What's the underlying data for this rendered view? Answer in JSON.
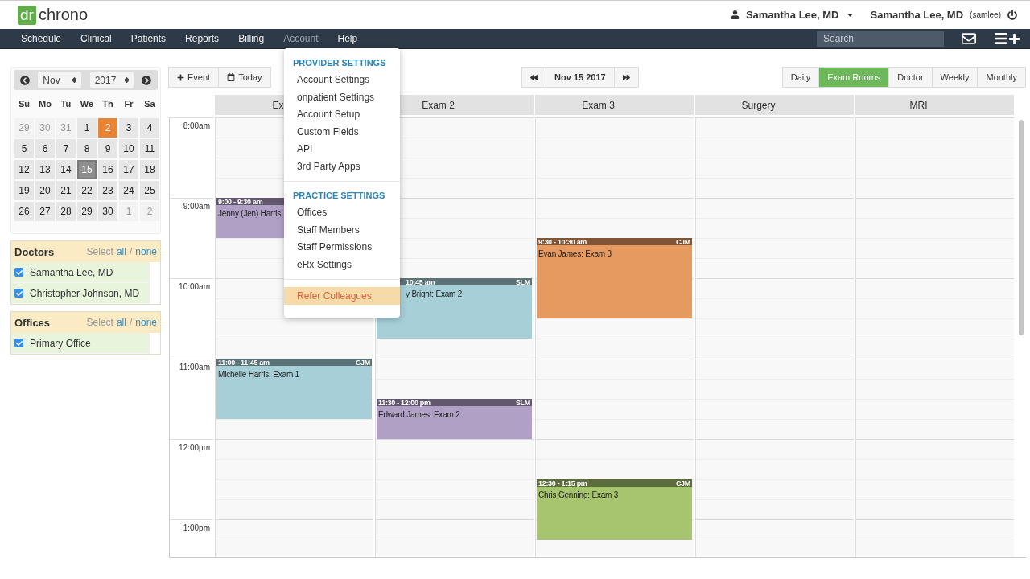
{
  "header": {
    "logo_mark": "dr",
    "logo_text": "chrono",
    "user_menu": "Samantha Lee, MD",
    "signed_in_name": "Samantha Lee, MD",
    "signed_in_login": "(samlee)"
  },
  "nav": {
    "items": [
      {
        "label": "Schedule",
        "hovered": false
      },
      {
        "label": "Clinical",
        "hovered": false
      },
      {
        "label": "Patients",
        "hovered": false
      },
      {
        "label": "Reports",
        "hovered": false
      },
      {
        "label": "Billing",
        "hovered": false
      },
      {
        "label": "Account",
        "hovered": true
      },
      {
        "label": "Help",
        "hovered": false
      }
    ],
    "search": {
      "placeholder": "Search"
    }
  },
  "account_menu": {
    "sections": [
      {
        "heading": "PROVIDER SETTINGS",
        "items": [
          {
            "label": "Account Settings",
            "highlighted": false
          },
          {
            "label": "onpatient Settings",
            "highlighted": false
          },
          {
            "label": "Account Setup",
            "highlighted": false
          },
          {
            "label": "Custom Fields",
            "highlighted": false
          },
          {
            "label": "API",
            "highlighted": false
          },
          {
            "label": "3rd Party Apps",
            "highlighted": false
          }
        ]
      },
      {
        "heading": "PRACTICE SETTINGS",
        "items": [
          {
            "label": "Offices",
            "highlighted": false
          },
          {
            "label": "Staff Members",
            "highlighted": false
          },
          {
            "label": "Staff Permissions",
            "highlighted": false
          },
          {
            "label": "eRx Settings",
            "highlighted": false
          }
        ]
      },
      {
        "items": [
          {
            "label": "Refer Colleagues",
            "highlighted": true
          }
        ]
      }
    ]
  },
  "mini_calendar": {
    "month": "Nov",
    "year": "2017",
    "weekdays": [
      "Su",
      "Mo",
      "Tu",
      "We",
      "Th",
      "Fr",
      "Sa"
    ],
    "days": [
      {
        "label": "29",
        "muted": true,
        "today": false,
        "selected": false
      },
      {
        "label": "30",
        "muted": true,
        "today": false,
        "selected": false
      },
      {
        "label": "31",
        "muted": true,
        "today": false,
        "selected": false
      },
      {
        "label": "1",
        "muted": false,
        "today": false,
        "selected": false
      },
      {
        "label": "2",
        "muted": false,
        "today": true,
        "selected": false
      },
      {
        "label": "3",
        "muted": false,
        "today": false,
        "selected": false
      },
      {
        "label": "4",
        "muted": false,
        "today": false,
        "selected": false
      },
      {
        "label": "5",
        "muted": false,
        "today": false,
        "selected": false
      },
      {
        "label": "6",
        "muted": false,
        "today": false,
        "selected": false
      },
      {
        "label": "7",
        "muted": false,
        "today": false,
        "selected": false
      },
      {
        "label": "8",
        "muted": false,
        "today": false,
        "selected": false
      },
      {
        "label": "9",
        "muted": false,
        "today": false,
        "selected": false
      },
      {
        "label": "10",
        "muted": false,
        "today": false,
        "selected": false
      },
      {
        "label": "11",
        "muted": false,
        "today": false,
        "selected": false
      },
      {
        "label": "12",
        "muted": false,
        "today": false,
        "selected": false
      },
      {
        "label": "13",
        "muted": false,
        "today": false,
        "selected": false
      },
      {
        "label": "14",
        "muted": false,
        "today": false,
        "selected": false
      },
      {
        "label": "15",
        "muted": false,
        "today": false,
        "selected": true
      },
      {
        "label": "16",
        "muted": false,
        "today": false,
        "selected": false
      },
      {
        "label": "17",
        "muted": false,
        "today": false,
        "selected": false
      },
      {
        "label": "18",
        "muted": false,
        "today": false,
        "selected": false
      },
      {
        "label": "19",
        "muted": false,
        "today": false,
        "selected": false
      },
      {
        "label": "20",
        "muted": false,
        "today": false,
        "selected": false
      },
      {
        "label": "21",
        "muted": false,
        "today": false,
        "selected": false
      },
      {
        "label": "22",
        "muted": false,
        "today": false,
        "selected": false
      },
      {
        "label": "23",
        "muted": false,
        "today": false,
        "selected": false
      },
      {
        "label": "24",
        "muted": false,
        "today": false,
        "selected": false
      },
      {
        "label": "25",
        "muted": false,
        "today": false,
        "selected": false
      },
      {
        "label": "26",
        "muted": false,
        "today": false,
        "selected": false
      },
      {
        "label": "27",
        "muted": false,
        "today": false,
        "selected": false
      },
      {
        "label": "28",
        "muted": false,
        "today": false,
        "selected": false
      },
      {
        "label": "29",
        "muted": false,
        "today": false,
        "selected": false
      },
      {
        "label": "30",
        "muted": false,
        "today": false,
        "selected": false
      },
      {
        "label": "1",
        "muted": true,
        "today": false,
        "selected": false
      },
      {
        "label": "2",
        "muted": true,
        "today": false,
        "selected": false
      }
    ]
  },
  "filters": [
    {
      "title": "Doctors",
      "select_label": "Select",
      "all_link": "all",
      "separator": "/",
      "none_link": "none",
      "items": [
        {
          "label": "Samantha Lee, MD",
          "checked": true
        },
        {
          "label": "Christopher Johnson, MD",
          "checked": true
        }
      ]
    },
    {
      "title": "Offices",
      "select_label": "Select",
      "all_link": "all",
      "separator": "/",
      "none_link": "none",
      "items": [
        {
          "label": "Primary Office",
          "checked": true
        }
      ]
    }
  ],
  "toolbar": {
    "event_button": "Event",
    "today_button": "Today",
    "date": "Nov 15 2017",
    "views": [
      {
        "label": "Daily",
        "selected": false
      },
      {
        "label": "Exam Rooms",
        "selected": true
      },
      {
        "label": "Doctor",
        "selected": false
      },
      {
        "label": "Weekly",
        "selected": false
      },
      {
        "label": "Monthly",
        "selected": false
      }
    ]
  },
  "schedule": {
    "hours": [
      "8:00am",
      "9:00am",
      "10:00am",
      "11:00am",
      "12:00pm",
      "1:00pm"
    ],
    "rooms": [
      {
        "name": "Ex",
        "events": [
          {
            "time": "9:00 - 9:30 am",
            "title": "Jenny (Jen) Harris:",
            "color": "#b1a0c6",
            "covered": false
          },
          {
            "time": "11:00 - 11:45 am",
            "initials": "CJM",
            "title": "Michelle Harris: Exam 1",
            "color": "#a6cfd8",
            "covered": false
          }
        ]
      },
      {
        "name": "Exam 2",
        "events": [
          {
            "time": "10:45 am",
            "initials": "SLM",
            "title": "y Bright: Exam 2",
            "color": "#a6cfd8",
            "covered": true
          },
          {
            "time": "11:30 - 12:00 pm",
            "initials": "SLM",
            "title": "Edward James: Exam 2",
            "color": "#b1a0c6",
            "covered": false
          }
        ]
      },
      {
        "name": "Exam 3",
        "events": [
          {
            "time": "9:30 - 10:30 am",
            "initials": "CJM",
            "title": "Evan James: Exam 3",
            "color": "#e69a60",
            "covered": false
          },
          {
            "time": "12:30 - 1:15 pm",
            "initials": "CJM",
            "title": "Chris Genning: Exam 3",
            "color": "#a7c46f",
            "covered": false
          }
        ]
      },
      {
        "name": "Surgery"
      },
      {
        "name": "MRI"
      }
    ]
  }
}
